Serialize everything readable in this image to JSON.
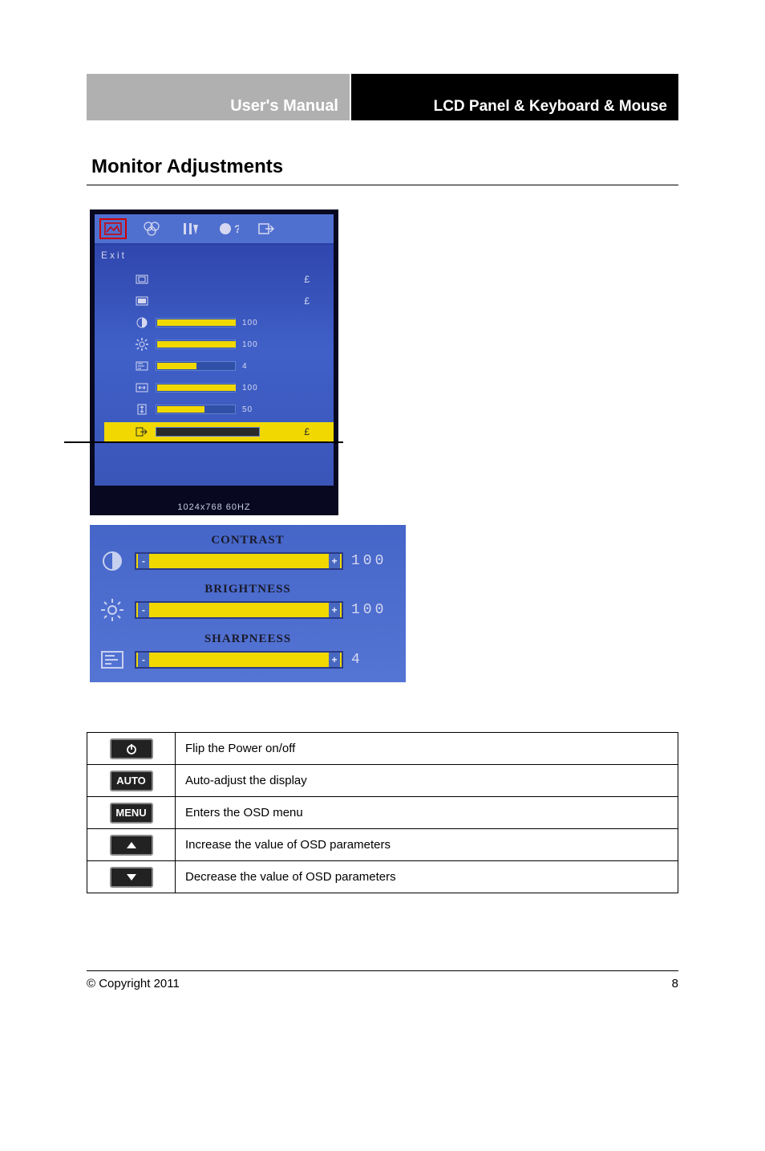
{
  "header": {
    "left": "User's Manual",
    "right": "LCD Panel & Keyboard & Mouse"
  },
  "section": {
    "title": "Monitor Adjustments"
  },
  "osd1": {
    "exit": "Exit",
    "status": "1024x768   60HZ",
    "rows": [
      {
        "type": "pound",
        "icon": "aspect-in",
        "value_label": "£"
      },
      {
        "type": "pound",
        "icon": "aspect-full",
        "value_label": "£"
      },
      {
        "type": "slider",
        "icon": "contrast",
        "value": 100,
        "fill": 100
      },
      {
        "type": "slider",
        "icon": "brightness",
        "value": 100,
        "fill": 100
      },
      {
        "type": "slider",
        "icon": "sharpness",
        "value": 4,
        "fill": 50
      },
      {
        "type": "slider",
        "icon": "hpos",
        "value": 100,
        "fill": 100
      },
      {
        "type": "slider",
        "icon": "vpos",
        "value": 50,
        "fill": 60
      },
      {
        "type": "pound",
        "icon": "exit-arrow",
        "value_label": "£",
        "highlight": true
      }
    ]
  },
  "osd2": {
    "items": [
      {
        "label": "CONTRAST",
        "icon": "contrast",
        "value": 100
      },
      {
        "label": "BRIGHTNESS",
        "icon": "brightness",
        "value": 100
      },
      {
        "label": "SHARPNEESS",
        "icon": "sharpness",
        "value": 4
      }
    ]
  },
  "buttons": [
    {
      "icon": "power",
      "label": "",
      "desc": "Flip the Power on/off"
    },
    {
      "icon": "text",
      "label": "AUTO",
      "desc": "Auto-adjust the display"
    },
    {
      "icon": "text",
      "label": "MENU",
      "desc": "Enters the OSD menu"
    },
    {
      "icon": "up",
      "label": "",
      "desc": "Increase the value of  OSD parameters"
    },
    {
      "icon": "down",
      "label": "",
      "desc": "Decrease the value of  OSD parameters"
    }
  ],
  "footer": {
    "copyright": "© Copyright 2011",
    "page": "8"
  }
}
